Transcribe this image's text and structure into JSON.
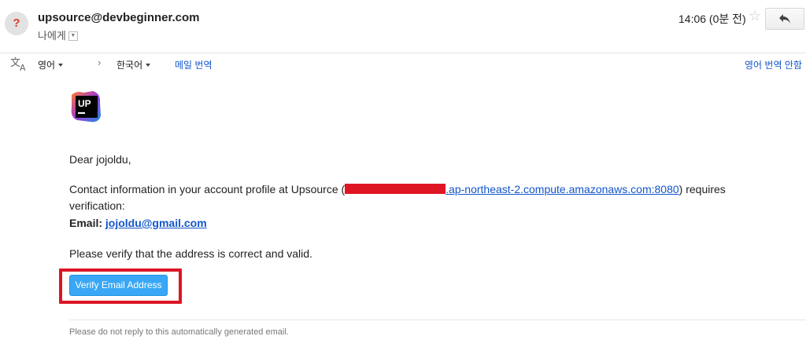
{
  "header": {
    "avatar_glyph": "?",
    "sender": "upsource@devbeginner.com",
    "recipient": "나에게",
    "time": "14:06 (0분 전)",
    "star_glyph": "☆",
    "reply_icon": "reply-icon"
  },
  "translate_bar": {
    "source_lang": "영어",
    "chevron": "›",
    "target_lang": "한국어",
    "translate_link": "메일 번역",
    "no_translate_link": "영어 번역 안함"
  },
  "message": {
    "logo_text": "UP",
    "greeting": "Dear jojoldu,",
    "contact_prefix": "Contact information in your account profile at Upsource (",
    "host_link_suffix": ".ap-northeast-2.compute.amazonaws.com:8080",
    "contact_suffix": ") requires",
    "contact_line2": "verification:",
    "email_label": "Email:",
    "email_value": "jojoldu@gmail.com",
    "instruction": "Please verify that the address is correct and valid.",
    "verify_button": "Verify Email Address",
    "footer_note": "Please do not reply to this automatically generated email."
  },
  "colors": {
    "link": "#1155cc",
    "verify_button_bg": "#39a7f5",
    "highlight_box": "#dc1524",
    "redaction": "#e01524"
  }
}
